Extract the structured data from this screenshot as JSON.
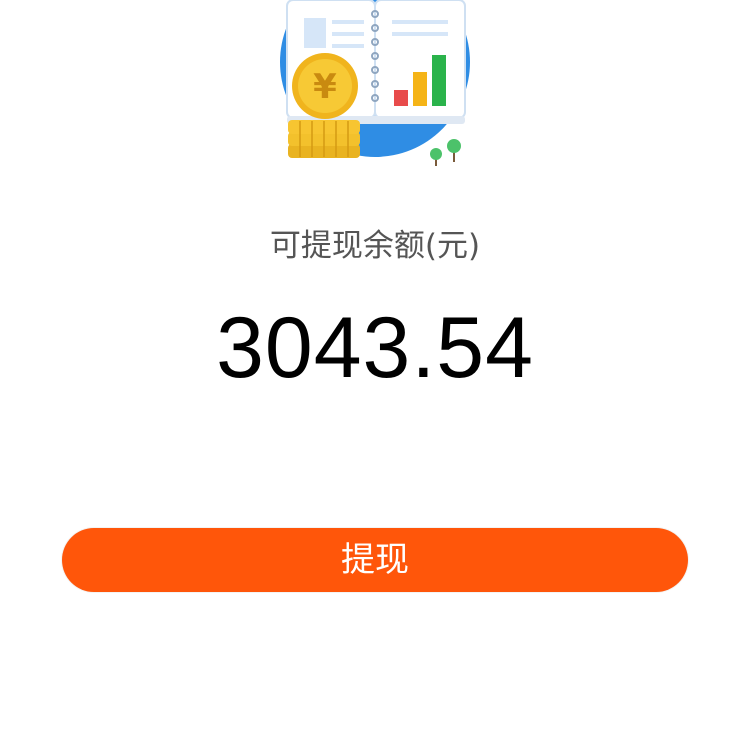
{
  "balance": {
    "label": "可提现余额(元)",
    "amount": "3043.54"
  },
  "actions": {
    "withdraw_label": "提现"
  },
  "colors": {
    "button": "#ff560a",
    "illustration_blue": "#2f8de4",
    "coin_gold": "#f7c531"
  },
  "icons": {
    "illustration": "ledger-with-coins-icon"
  }
}
